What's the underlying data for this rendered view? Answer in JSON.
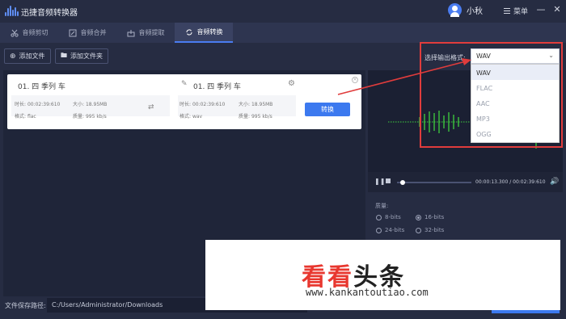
{
  "app": {
    "title": "迅捷音频转换器"
  },
  "user": {
    "name": "小秋"
  },
  "menu": {
    "label": "菜单"
  },
  "tabs": [
    {
      "label": "音频剪切"
    },
    {
      "label": "音频合并"
    },
    {
      "label": "音频提取"
    },
    {
      "label": "音频转换",
      "active": true
    }
  ],
  "toolbar": {
    "add_file": "添加文件",
    "add_folder": "添加文件夹"
  },
  "format": {
    "label": "选择输出格式:",
    "selected": "WAV",
    "options": [
      "WAV",
      "FLAC",
      "AAC",
      "MP3",
      "OGG"
    ]
  },
  "file": {
    "source": {
      "name": "01. 四 季列 车",
      "duration_label": "时长:",
      "duration": "00:02:39:610",
      "size_label": "大小:",
      "size": "18.95MB",
      "format_label": "格式:",
      "format": "flac",
      "quality_label": "质量:",
      "quality": "995 kb/s"
    },
    "target": {
      "name": "01. 四 季列 车",
      "duration_label": "时长:",
      "duration": "00:02:39:610",
      "size_label": "大小:",
      "size": "18.95MB",
      "format_label": "格式:",
      "format": "wav",
      "quality_label": "质量:",
      "quality": "995 kb/s"
    },
    "convert_label": "转换"
  },
  "player": {
    "time": "00:00:13.300 / 00:02:39:610"
  },
  "quality": {
    "label": "质量:",
    "options": [
      {
        "label": "8-bits",
        "checked": false
      },
      {
        "label": "16-bits",
        "checked": true
      },
      {
        "label": "24-bits",
        "checked": false
      },
      {
        "label": "32-bits",
        "checked": false
      }
    ]
  },
  "save": {
    "label": "文件保存路径:",
    "path": "C:/Users/Administrator/Downloads"
  },
  "watermark": {
    "title": "看看头条",
    "url": "www.kankantoutiao.com"
  },
  "colors": {
    "accent": "#3c79ef",
    "annotation": "#e03c3c",
    "waveform": "#3fcf3f"
  }
}
